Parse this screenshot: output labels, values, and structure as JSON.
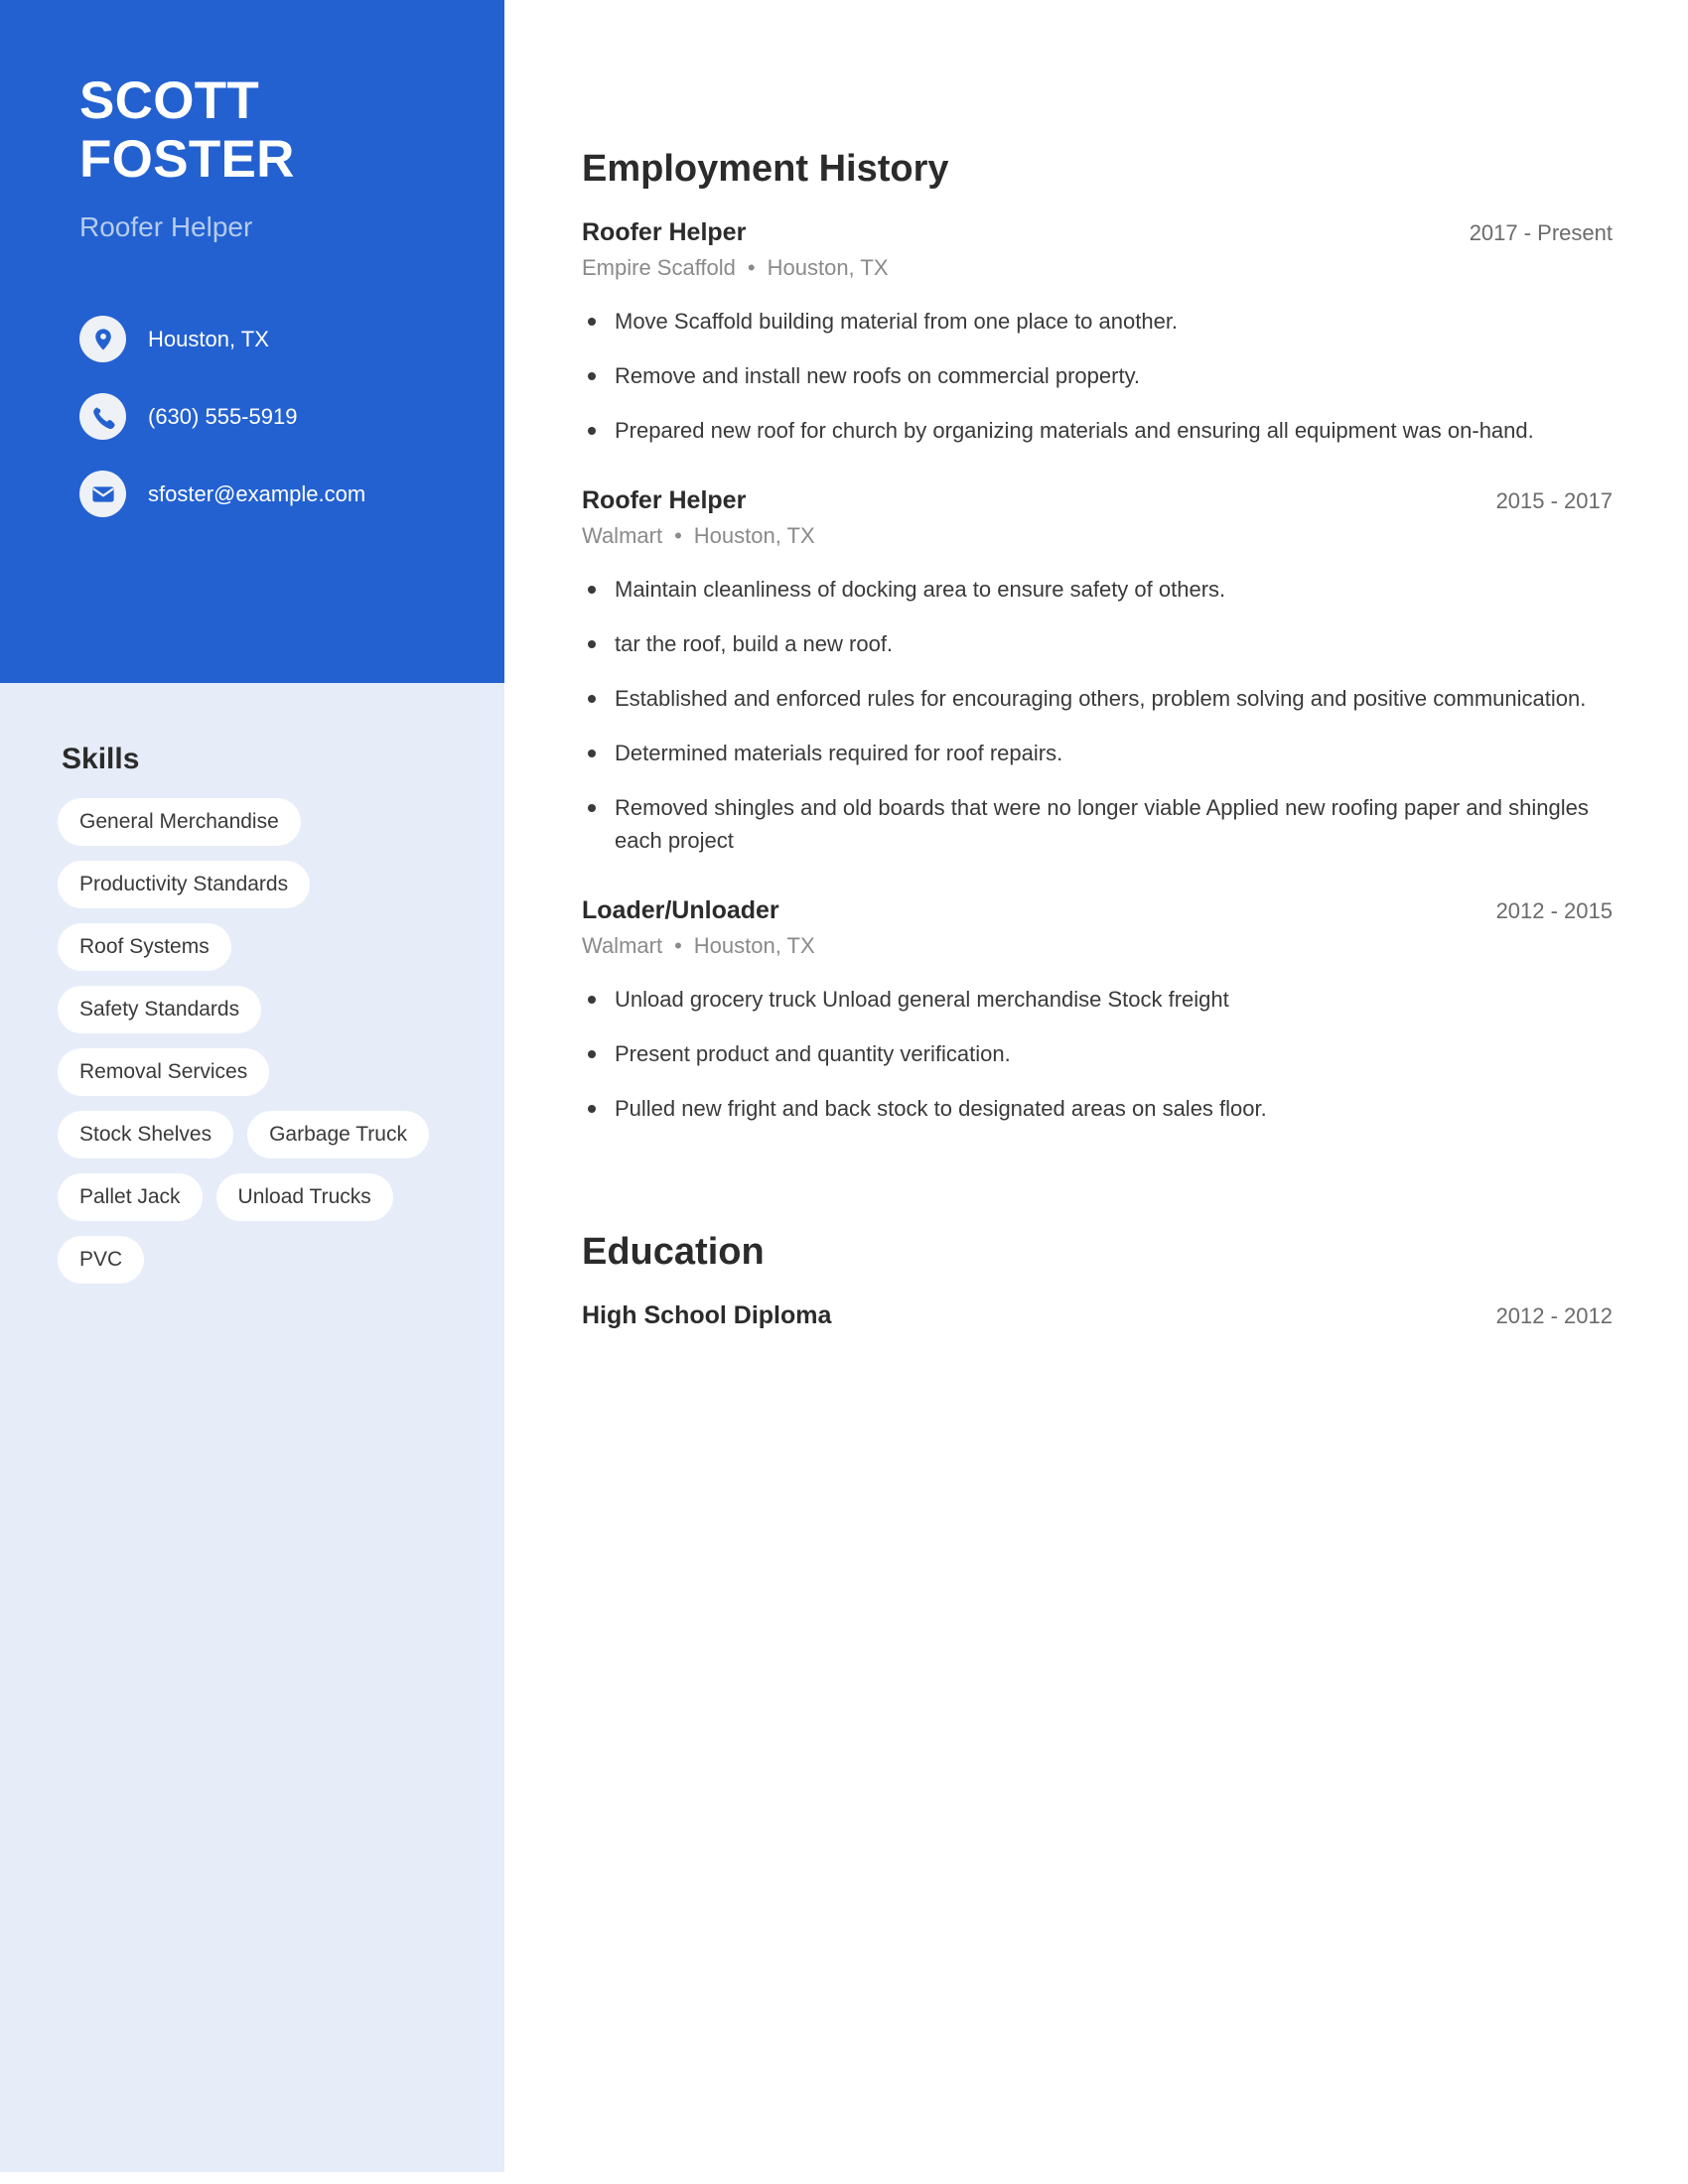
{
  "colors": {
    "accent": "#2361d1",
    "sidebar_bg": "#e6ecf8",
    "tag_bg": "#ffffff",
    "heading": "#2b2b2b",
    "muted": "#8a8a8a"
  },
  "sidebar": {
    "name_first": "SCOTT",
    "name_last": "FOSTER",
    "job_title": "Roofer Helper",
    "contacts": [
      {
        "icon": "location-pin-icon",
        "text": "Houston, TX"
      },
      {
        "icon": "phone-icon",
        "text": "(630) 555-5919"
      },
      {
        "icon": "envelope-icon",
        "text": "sfoster@example.com"
      }
    ],
    "skills_heading": "Skills",
    "skills": [
      "General Merchandise",
      "Productivity Standards",
      "Roof Systems",
      "Safety Standards",
      "Removal Services",
      "Stock Shelves",
      "Garbage Truck",
      "Pallet Jack",
      "Unload Trucks",
      "PVC"
    ]
  },
  "main": {
    "employment_heading": "Employment History",
    "education_heading": "Education",
    "separator": "•",
    "jobs": [
      {
        "role": "Roofer Helper",
        "dates": "2017 - Present",
        "company": "Empire Scaffold",
        "location": "Houston, TX",
        "bullets": [
          "Move Scaffold building material from one place to another.",
          "Remove and install new roofs on commercial property.",
          "Prepared new roof for church by organizing materials and ensuring all equipment was on-hand."
        ]
      },
      {
        "role": "Roofer Helper",
        "dates": "2015 - 2017",
        "company": "Walmart",
        "location": "Houston, TX",
        "bullets": [
          "Maintain cleanliness of docking area to ensure safety of others.",
          "tar the roof, build a new roof.",
          "Established and enforced rules for encouraging others, problem solving and positive communication.",
          "Determined materials required for roof repairs.",
          "Removed shingles and old boards that were no longer viable Applied new roofing paper and shingles each project"
        ]
      },
      {
        "role": "Loader/Unloader",
        "dates": "2012 - 2015",
        "company": "Walmart",
        "location": "Houston, TX",
        "bullets": [
          "Unload grocery truck Unload general merchandise Stock freight",
          "Present product and quantity verification.",
          "Pulled new fright and back stock to designated areas on sales floor."
        ]
      }
    ],
    "education": [
      {
        "degree": "High School Diploma",
        "dates": "2012 - 2012"
      }
    ]
  }
}
